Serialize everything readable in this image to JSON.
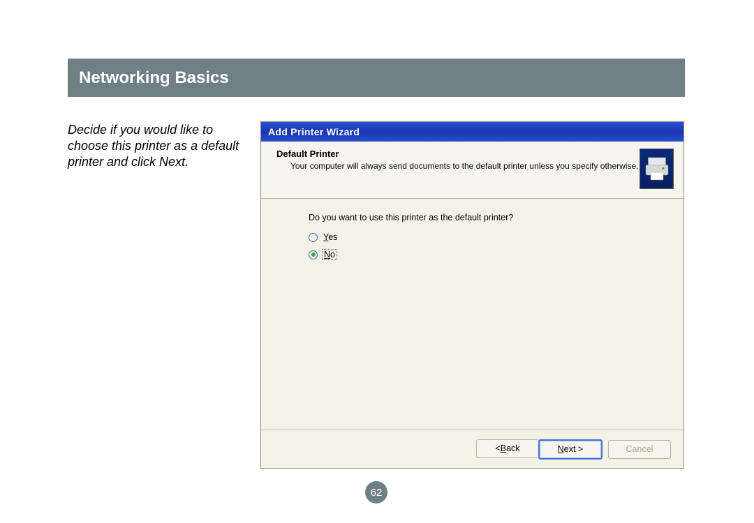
{
  "header": {
    "title": "Networking Basics"
  },
  "instruction": "Decide if you would like to choose this printer as a default printer and click Next.",
  "wizard": {
    "title": "Add Printer Wizard",
    "section_title": "Default Printer",
    "section_sub": "Your computer will always send documents to the default printer unless you specify otherwise.",
    "question": "Do you want to use this printer as the default printer?",
    "options": {
      "yes_prefix": "Y",
      "yes_rest": "es",
      "no_prefix": "N",
      "no_rest": "o",
      "selected": "no"
    },
    "buttons": {
      "back_lt": "< ",
      "back_u": "B",
      "back_rest": "ack",
      "next_u": "N",
      "next_rest": "ext >",
      "cancel": "Cancel"
    }
  },
  "page_number": "62"
}
